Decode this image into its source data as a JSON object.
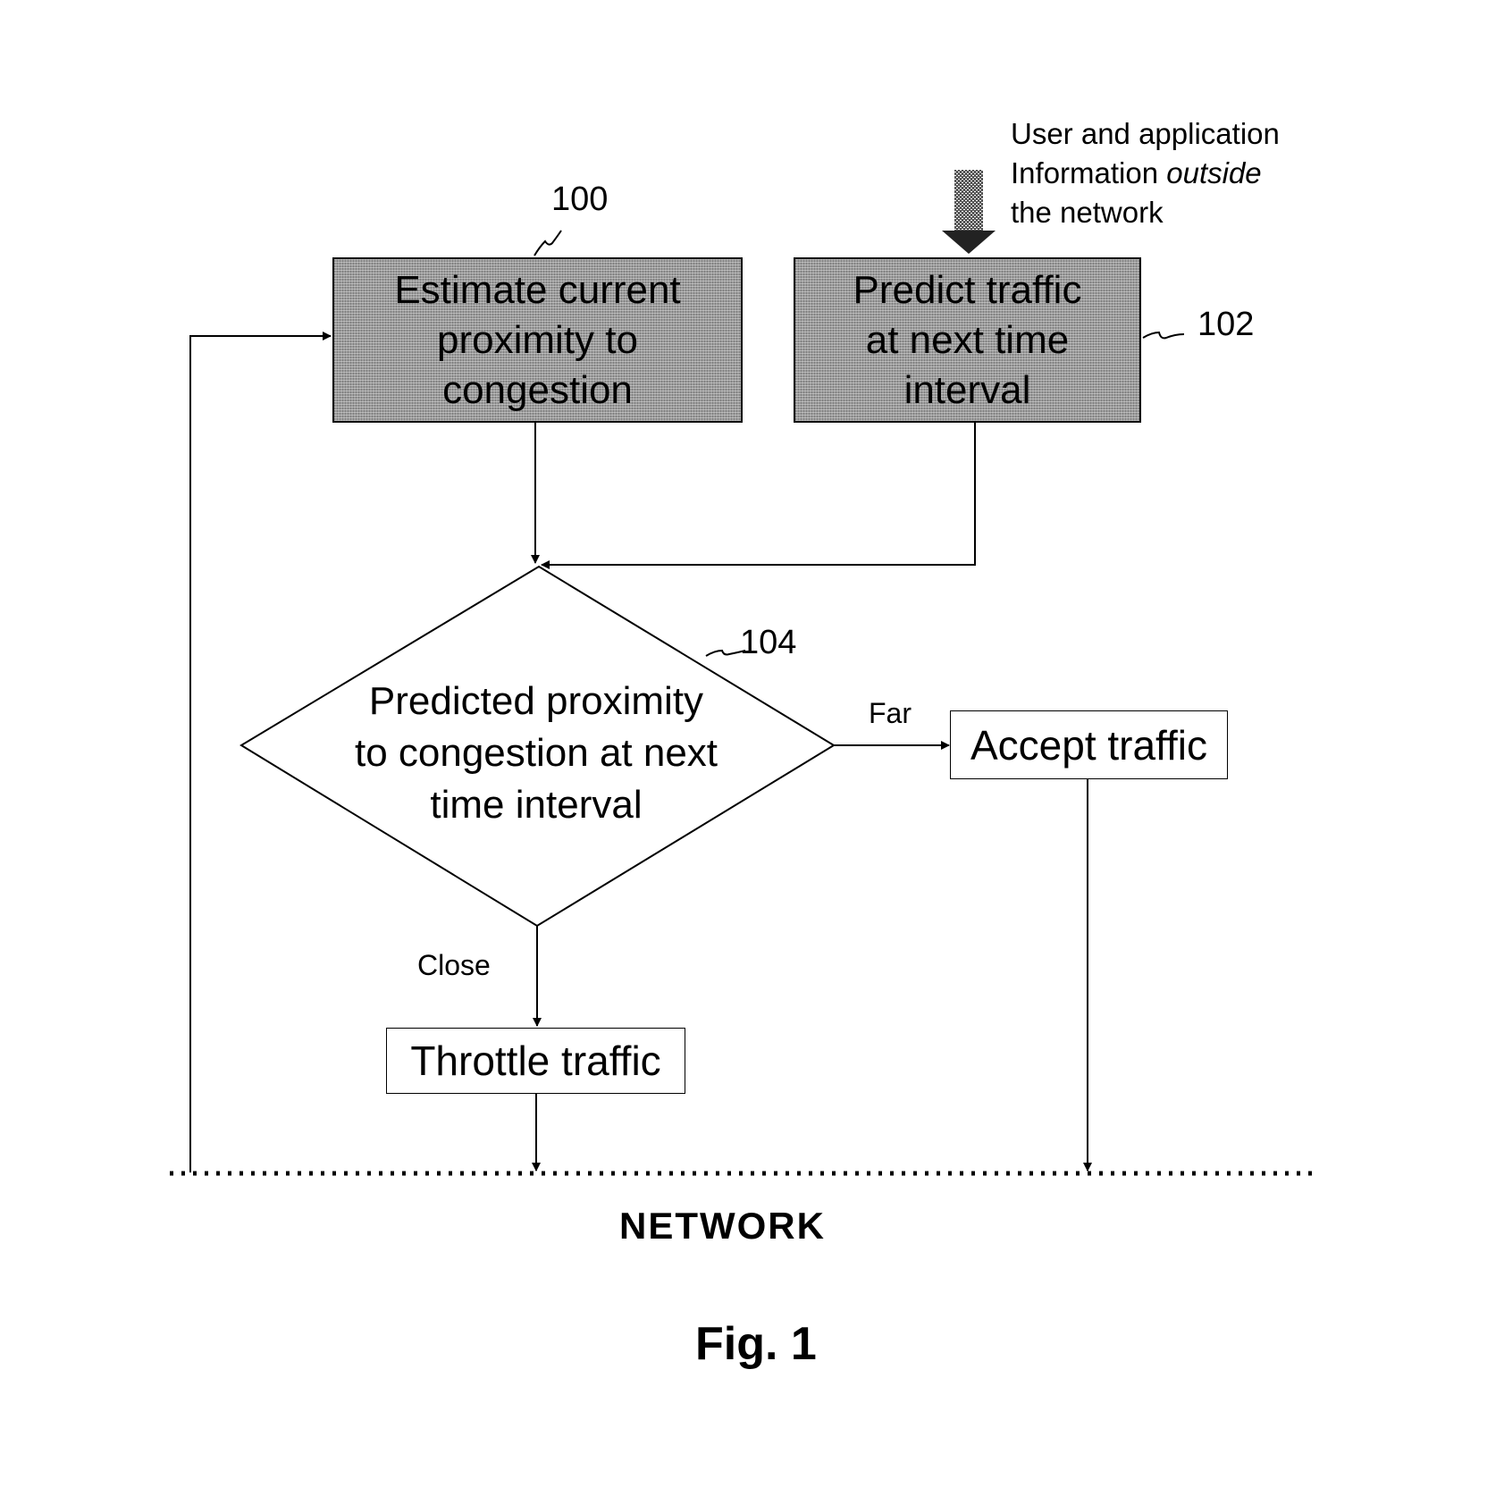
{
  "figure": {
    "caption": "Fig. 1",
    "network_label": "NETWORK"
  },
  "nodes": {
    "estimate": {
      "ref": "100",
      "lines": [
        "Estimate current",
        "proximity to",
        "congestion"
      ]
    },
    "predict": {
      "ref": "102",
      "lines": [
        "Predict traffic",
        "at next time",
        "interval"
      ]
    },
    "decision": {
      "ref": "104",
      "lines": [
        "Predicted proximity",
        "to congestion at next",
        "time interval"
      ]
    },
    "accept": {
      "label": "Accept traffic"
    },
    "throttle": {
      "label": "Throttle traffic"
    }
  },
  "edges": {
    "far_label": "Far",
    "close_label": "Close"
  },
  "external_input": {
    "line1": "User and application",
    "line2_prefix": "Information ",
    "line2_emphasis": "outside",
    "line3": "the network"
  }
}
